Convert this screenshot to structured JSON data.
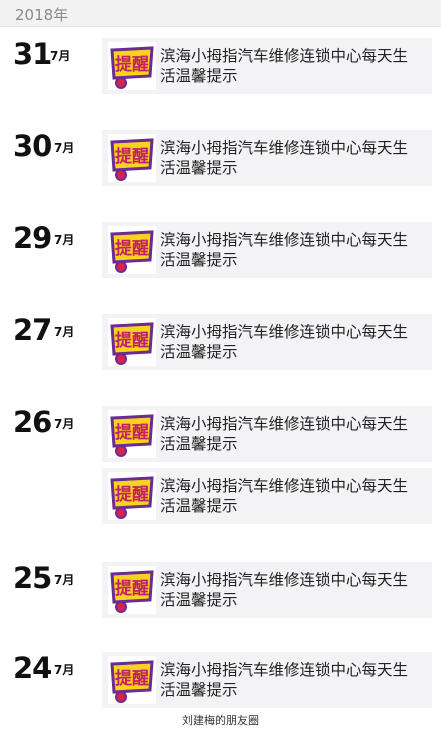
{
  "header": {
    "year": "2018年"
  },
  "entries": [
    {
      "day": "31",
      "month": "7月",
      "posts": [
        "滨海小拇指汽车维修连锁中心每天生活温馨提示"
      ]
    },
    {
      "day": "30",
      "month": "7月",
      "posts": [
        "滨海小拇指汽车维修连锁中心每天生活温馨提示"
      ]
    },
    {
      "day": "29",
      "month": "7月",
      "posts": [
        "滨海小拇指汽车维修连锁中心每天生活温馨提示"
      ]
    },
    {
      "day": "27",
      "month": "7月",
      "posts": [
        "滨海小拇指汽车维修连锁中心每天生活温馨提示"
      ]
    },
    {
      "day": "26",
      "month": "7月",
      "posts": [
        "滨海小拇指汽车维修连锁中心每天生活温馨提示",
        "滨海小拇指汽车维修连锁中心每天生活温馨提示"
      ]
    },
    {
      "day": "25",
      "month": "7月",
      "posts": [
        "滨海小拇指汽车维修连锁中心每天生活温馨提示"
      ]
    },
    {
      "day": "24",
      "month": "7月",
      "posts": [
        "滨海小拇指汽车维修连锁中心每天生活温馨提示"
      ]
    }
  ],
  "thumbnail": {
    "icon": "tips-sticker-icon",
    "text": "提醒"
  },
  "footer": {
    "caption": "刘建梅的朋友圈"
  }
}
